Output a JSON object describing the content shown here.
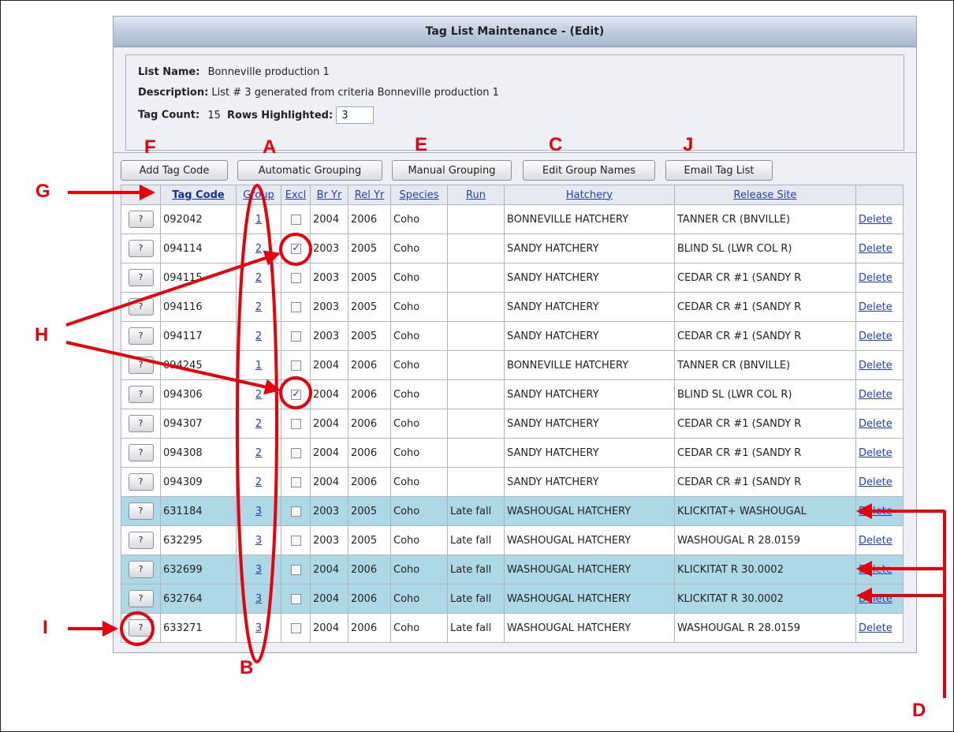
{
  "window": {
    "title": "Tag List Maintenance - (Edit)"
  },
  "info": {
    "list_name_label": "List Name:",
    "list_name": "Bonneville production 1",
    "description_label": "Description:",
    "description": "List # 3 generated from criteria Bonneville production 1",
    "tag_count_label": "Tag Count:",
    "tag_count": "15",
    "rows_highlighted_label": "Rows Highlighted:",
    "rows_highlighted": "3"
  },
  "toolbar": {
    "add_tag_code": "Add Tag Code",
    "automatic_grouping": "Automatic Grouping",
    "manual_grouping": "Manual Grouping",
    "edit_group_names": "Edit Group Names",
    "email_tag_list": "Email Tag List"
  },
  "table": {
    "headers": {
      "tag_code": "Tag Code",
      "group": "Group",
      "excl": "Excl",
      "br_yr": "Br Yr",
      "rel_yr": "Rel Yr",
      "species": "Species",
      "run": "Run",
      "hatchery": "Hatchery",
      "release_site": "Release Site"
    },
    "row_button_label": "?",
    "delete_label": "Delete",
    "rows": [
      {
        "tag": "092042",
        "group": "1",
        "excl": false,
        "br": "2004",
        "rel": "2006",
        "species": "Coho",
        "run": "",
        "hatchery": "BONNEVILLE HATCHERY",
        "site": "TANNER CR (BNVILLE)",
        "highlight": false
      },
      {
        "tag": "094114",
        "group": "2",
        "excl": true,
        "br": "2003",
        "rel": "2005",
        "species": "Coho",
        "run": "",
        "hatchery": "SANDY HATCHERY",
        "site": "BLIND SL (LWR COL R)",
        "highlight": false
      },
      {
        "tag": "094115",
        "group": "2",
        "excl": false,
        "br": "2003",
        "rel": "2005",
        "species": "Coho",
        "run": "",
        "hatchery": "SANDY HATCHERY",
        "site": "CEDAR CR #1 (SANDY R",
        "highlight": false
      },
      {
        "tag": "094116",
        "group": "2",
        "excl": false,
        "br": "2003",
        "rel": "2005",
        "species": "Coho",
        "run": "",
        "hatchery": "SANDY HATCHERY",
        "site": "CEDAR CR #1 (SANDY R",
        "highlight": false
      },
      {
        "tag": "094117",
        "group": "2",
        "excl": false,
        "br": "2003",
        "rel": "2005",
        "species": "Coho",
        "run": "",
        "hatchery": "SANDY HATCHERY",
        "site": "CEDAR CR #1 (SANDY R",
        "highlight": false
      },
      {
        "tag": "094245",
        "group": "1",
        "excl": false,
        "br": "2004",
        "rel": "2006",
        "species": "Coho",
        "run": "",
        "hatchery": "BONNEVILLE HATCHERY",
        "site": "TANNER CR (BNVILLE)",
        "highlight": false
      },
      {
        "tag": "094306",
        "group": "2",
        "excl": true,
        "br": "2004",
        "rel": "2006",
        "species": "Coho",
        "run": "",
        "hatchery": "SANDY HATCHERY",
        "site": "BLIND SL (LWR COL R)",
        "highlight": false
      },
      {
        "tag": "094307",
        "group": "2",
        "excl": false,
        "br": "2004",
        "rel": "2006",
        "species": "Coho",
        "run": "",
        "hatchery": "SANDY HATCHERY",
        "site": "CEDAR CR #1 (SANDY R",
        "highlight": false
      },
      {
        "tag": "094308",
        "group": "2",
        "excl": false,
        "br": "2004",
        "rel": "2006",
        "species": "Coho",
        "run": "",
        "hatchery": "SANDY HATCHERY",
        "site": "CEDAR CR #1 (SANDY R",
        "highlight": false
      },
      {
        "tag": "094309",
        "group": "2",
        "excl": false,
        "br": "2004",
        "rel": "2006",
        "species": "Coho",
        "run": "",
        "hatchery": "SANDY HATCHERY",
        "site": "CEDAR CR #1 (SANDY R",
        "highlight": false
      },
      {
        "tag": "631184",
        "group": "3",
        "excl": false,
        "br": "2003",
        "rel": "2005",
        "species": "Coho",
        "run": "Late fall",
        "hatchery": "WASHOUGAL HATCHERY",
        "site": "KLICKITAT+ WASHOUGAL",
        "highlight": true
      },
      {
        "tag": "632295",
        "group": "3",
        "excl": false,
        "br": "2003",
        "rel": "2005",
        "species": "Coho",
        "run": "Late fall",
        "hatchery": "WASHOUGAL HATCHERY",
        "site": "WASHOUGAL R 28.0159",
        "highlight": false
      },
      {
        "tag": "632699",
        "group": "3",
        "excl": false,
        "br": "2004",
        "rel": "2006",
        "species": "Coho",
        "run": "Late fall",
        "hatchery": "WASHOUGAL HATCHERY",
        "site": "KLICKITAT R 30.0002",
        "highlight": true
      },
      {
        "tag": "632764",
        "group": "3",
        "excl": false,
        "br": "2004",
        "rel": "2006",
        "species": "Coho",
        "run": "Late fall",
        "hatchery": "WASHOUGAL HATCHERY",
        "site": "KLICKITAT R 30.0002",
        "highlight": true
      },
      {
        "tag": "633271",
        "group": "3",
        "excl": false,
        "br": "2004",
        "rel": "2006",
        "species": "Coho",
        "run": "Late fall",
        "hatchery": "WASHOUGAL HATCHERY",
        "site": "WASHOUGAL R 28.0159",
        "highlight": false
      }
    ]
  },
  "annotations": {
    "A": "A",
    "B": "B",
    "C": "C",
    "D": "D",
    "E": "E",
    "F": "F",
    "G": "G",
    "H": "H",
    "I": "I",
    "J": "J"
  },
  "colors": {
    "annotation": "#e8000b",
    "highlight_row": "#add8e6",
    "link": "#1f3fbf"
  }
}
